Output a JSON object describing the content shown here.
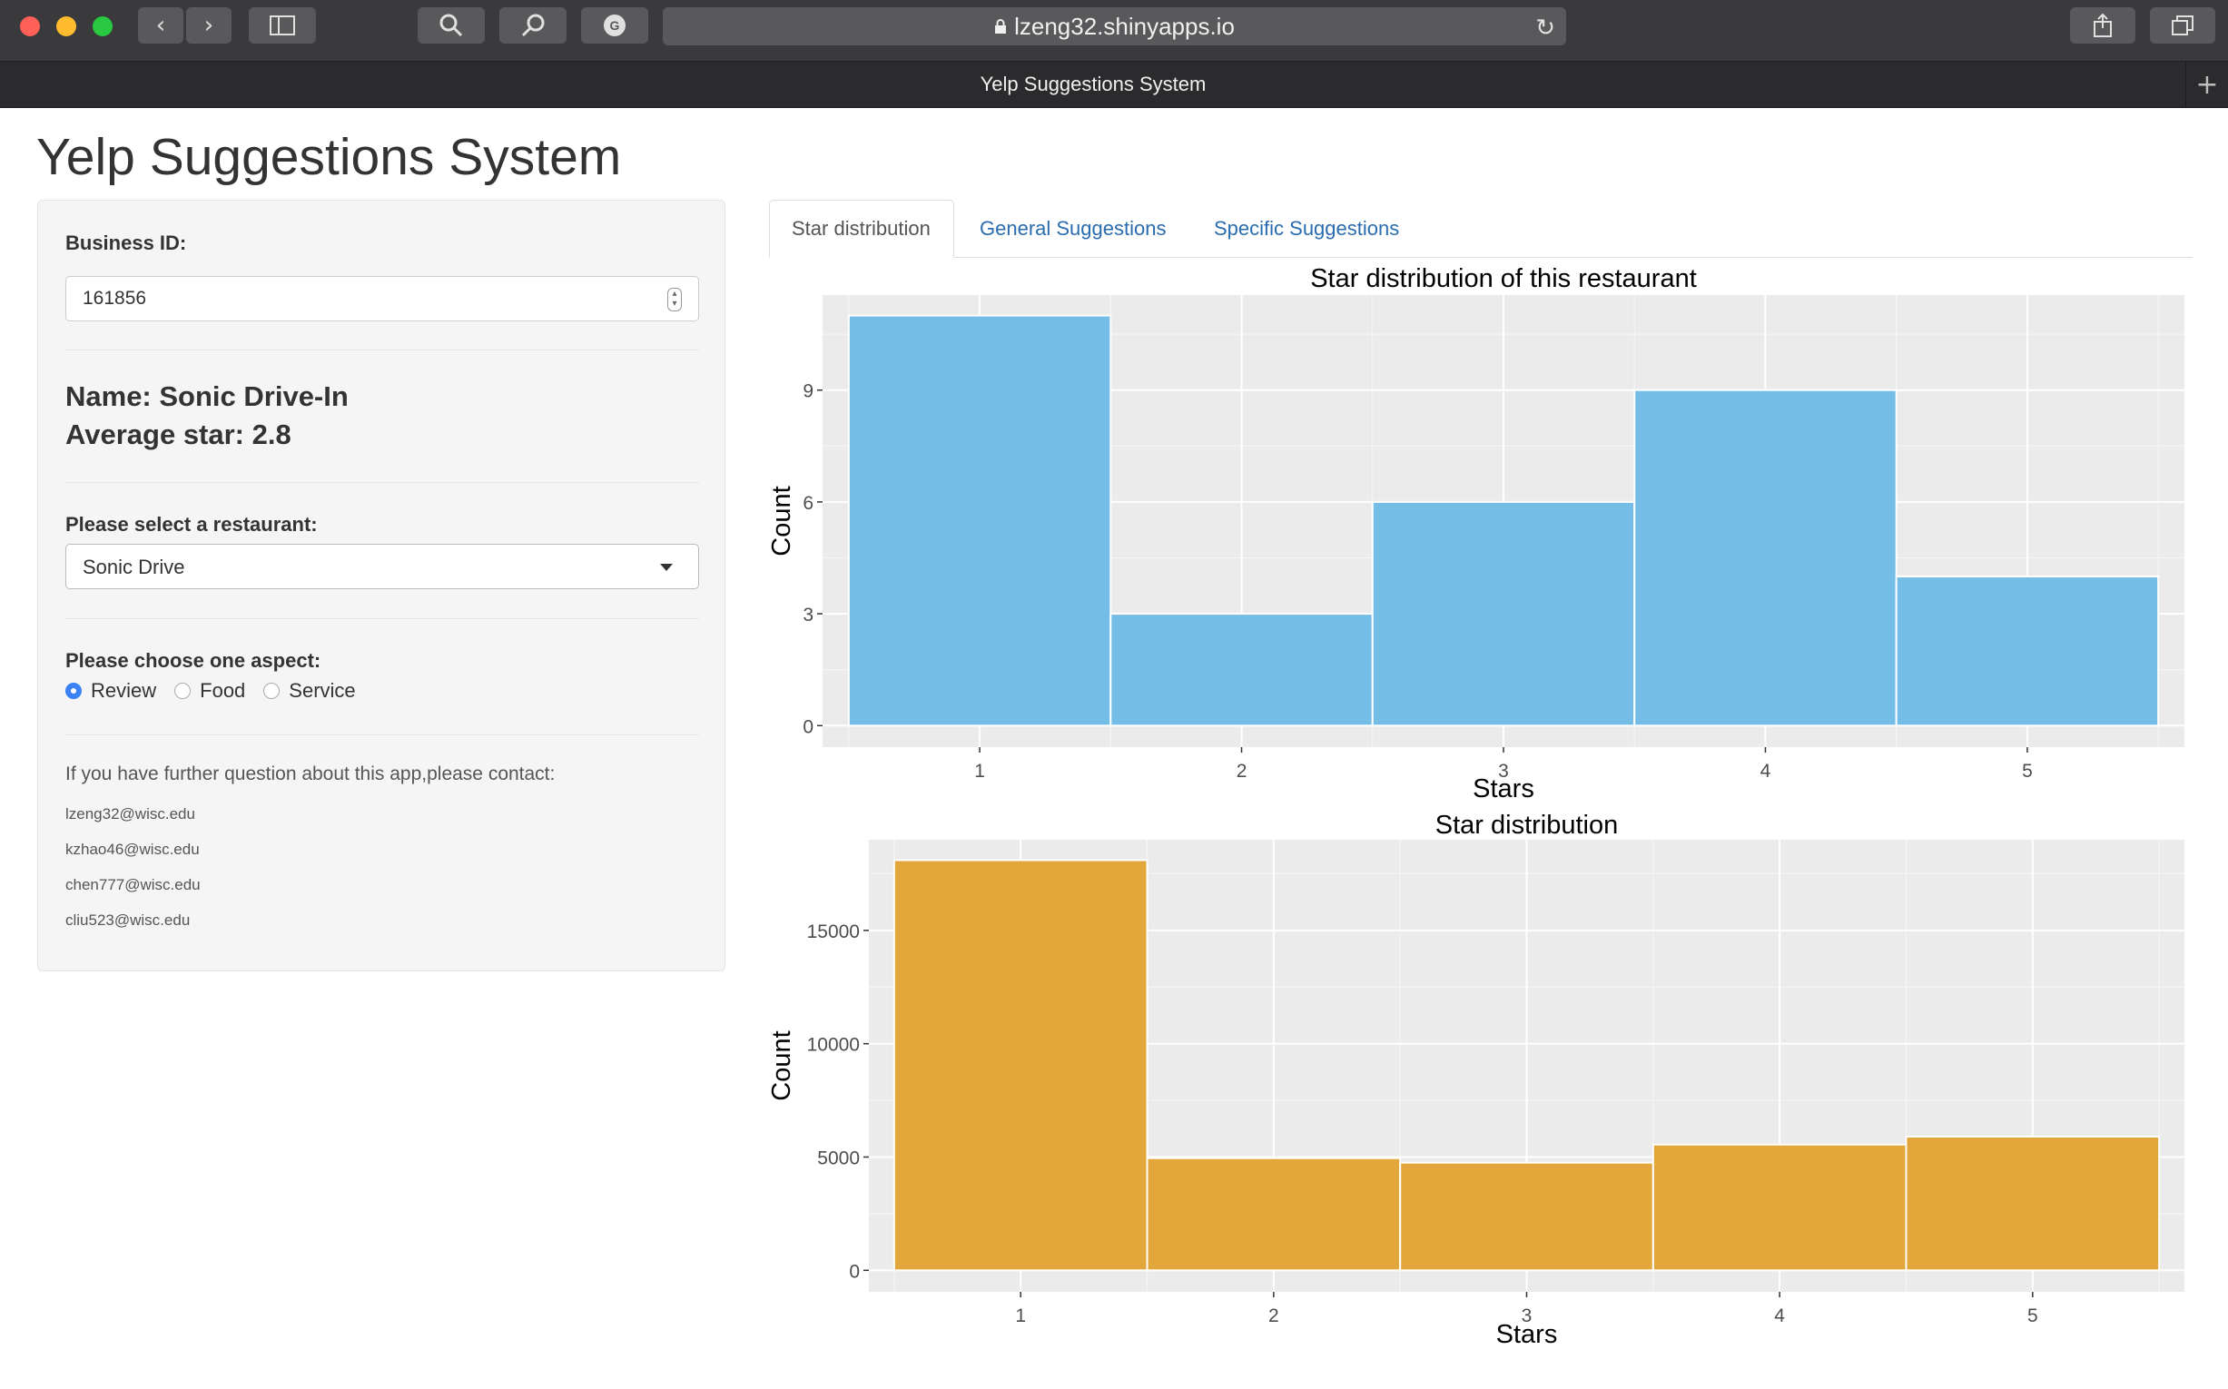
{
  "browser": {
    "url": "lzeng32.shinyapps.io",
    "tab_title": "Yelp Suggestions System"
  },
  "page": {
    "title": "Yelp Suggestions System"
  },
  "sidebar": {
    "business_id_label": "Business ID:",
    "business_id_value": "161856",
    "name_text": "Name: Sonic Drive-In",
    "avg_star_text": "Average star: 2.8",
    "restaurant_label": "Please select a restaurant:",
    "restaurant_selected": "Sonic Drive",
    "aspect_label": "Please choose one aspect:",
    "aspects": [
      {
        "label": "Review",
        "selected": true
      },
      {
        "label": "Food",
        "selected": false
      },
      {
        "label": "Service",
        "selected": false
      }
    ],
    "contact_heading": "If you have further question about this app,please contact:",
    "emails": [
      "lzeng32@wisc.edu",
      "kzhao46@wisc.edu",
      "chen777@wisc.edu",
      "cliu523@wisc.edu"
    ]
  },
  "tabs": [
    {
      "label": "Star distribution",
      "active": true
    },
    {
      "label": "General Suggestions",
      "active": false
    },
    {
      "label": "Specific Suggestions",
      "active": false
    }
  ],
  "chart_data": [
    {
      "type": "bar",
      "title": "Star distribution of this restaurant",
      "xlabel": "Stars",
      "ylabel": "Count",
      "categories": [
        "1",
        "2",
        "3",
        "4",
        "5"
      ],
      "values": [
        11,
        3,
        6,
        9,
        4
      ],
      "yticks": [
        0,
        3,
        6,
        9
      ],
      "yticklabels": [
        "0",
        "3",
        "6",
        "9"
      ],
      "ylim": [
        0,
        11.55
      ],
      "color": "#74bde6",
      "grid": true,
      "legend": "none"
    },
    {
      "type": "bar",
      "title": "Star distribution",
      "xlabel": "Stars",
      "ylabel": "Count",
      "categories": [
        "1",
        "2",
        "3",
        "4",
        "5"
      ],
      "values": [
        18100,
        4950,
        4750,
        5550,
        5900
      ],
      "yticks": [
        0,
        5000,
        10000,
        15000
      ],
      "yticklabels": [
        "0",
        "5000",
        "10000",
        "15000"
      ],
      "ylim": [
        0,
        19000
      ],
      "color": "#e3a63a",
      "grid": true,
      "legend": "none"
    }
  ]
}
